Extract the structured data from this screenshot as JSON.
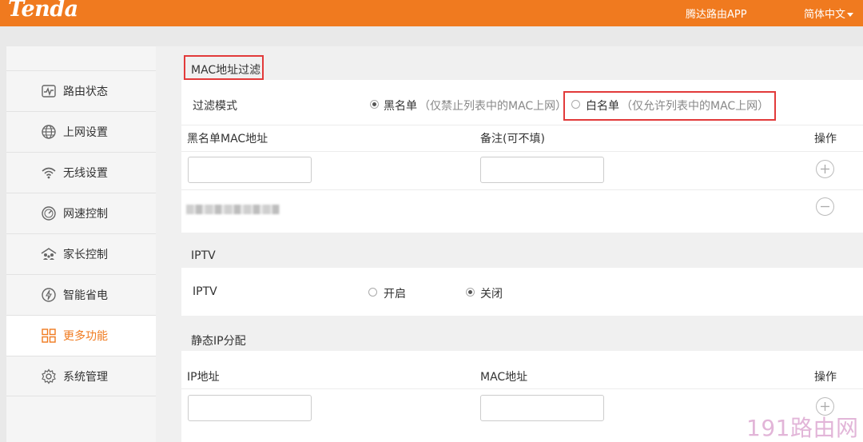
{
  "header": {
    "logo": "Tenda",
    "app_link": "腾达路由APP",
    "language": "简体中文"
  },
  "sidebar": {
    "items": [
      {
        "label": "路由状态",
        "icon": "pulse-icon"
      },
      {
        "label": "上网设置",
        "icon": "globe-icon"
      },
      {
        "label": "无线设置",
        "icon": "wifi-icon"
      },
      {
        "label": "网速控制",
        "icon": "speedometer-icon"
      },
      {
        "label": "家长控制",
        "icon": "family-icon"
      },
      {
        "label": "智能省电",
        "icon": "power-saving-icon"
      },
      {
        "label": "更多功能",
        "icon": "grid-icon",
        "active": true
      },
      {
        "label": "系统管理",
        "icon": "gear-icon"
      }
    ]
  },
  "mac_filter": {
    "title": "MAC地址过滤",
    "mode_label": "过滤模式",
    "blacklist_label": "黑名单",
    "blacklist_hint": "（仅禁止列表中的MAC上网）",
    "whitelist_label": "白名单",
    "whitelist_hint": "（仅允许列表中的MAC上网）",
    "selected_mode": "blacklist",
    "columns": {
      "mac": "黑名单MAC地址",
      "remark": "备注(可不填)",
      "action": "操作"
    },
    "mac_input_value": "",
    "remark_input_value": ""
  },
  "iptv": {
    "title": "IPTV",
    "label": "IPTV",
    "on_label": "开启",
    "off_label": "关闭",
    "selected": "off"
  },
  "static_ip": {
    "title": "静态IP分配",
    "columns": {
      "ip": "IP地址",
      "mac": "MAC地址",
      "action": "操作"
    },
    "ip_input_value": "",
    "mac_input_value": ""
  },
  "watermark": "191路由网",
  "colors": {
    "brand": "#f07a1f",
    "highlight": "#e23a3a"
  }
}
